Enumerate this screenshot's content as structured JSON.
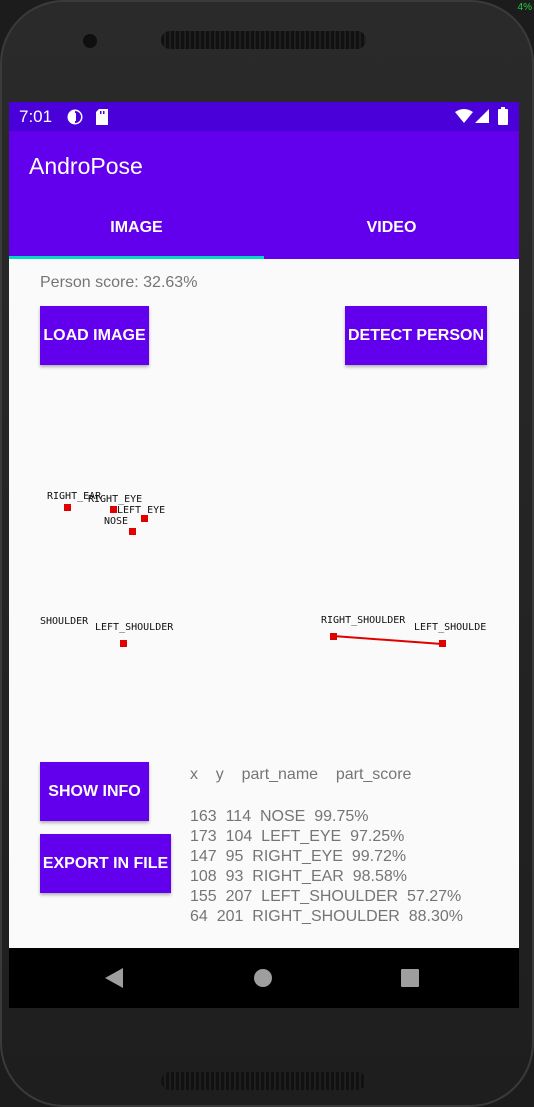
{
  "device": {
    "corner_badge": "4%"
  },
  "status_bar": {
    "time": "7:01"
  },
  "app_bar": {
    "title": "AndroPose"
  },
  "tabs": [
    {
      "label": "IMAGE",
      "selected": true
    },
    {
      "label": "VIDEO",
      "selected": false
    }
  ],
  "main": {
    "person_score": "Person score: 32.63%",
    "load_image_label": "LOAD IMAGE",
    "detect_person_label": "DETECT PERSON",
    "show_info_label": "SHOW INFO",
    "export_label": "EXPORT IN FILE"
  },
  "pose_labels": {
    "right_ear": "RIGHT_EAR",
    "right_eye": "RIGHT_EYE",
    "left_eye": "LEFT_EYE",
    "nose": "NOSE",
    "shoulder_partial": "SHOULDER",
    "left_shoulder_1": "LEFT_SHOULDER",
    "right_shoulder": "RIGHT_SHOULDER",
    "left_shoulder_2": "LEFT_SHOULDE"
  },
  "info_table": {
    "header": "x    y    part_name    part_score",
    "rows": [
      "163  114  NOSE  99.75%",
      "173  104  LEFT_EYE  97.25%",
      "147  95  RIGHT_EYE  99.72%",
      "108  93  RIGHT_EAR  98.58%",
      "155  207  LEFT_SHOULDER  57.27%",
      "64  201  RIGHT_SHOULDER  88.30%"
    ]
  },
  "colors": {
    "primary": "#6200ee",
    "status_bar": "#4a00d8",
    "accent": "#03dac5",
    "keypoint": "#e00000"
  },
  "icons": [
    "data-saver-icon",
    "sd-card-icon",
    "wifi-icon",
    "signal-icon",
    "battery-icon",
    "back-icon",
    "home-icon",
    "recents-icon"
  ]
}
